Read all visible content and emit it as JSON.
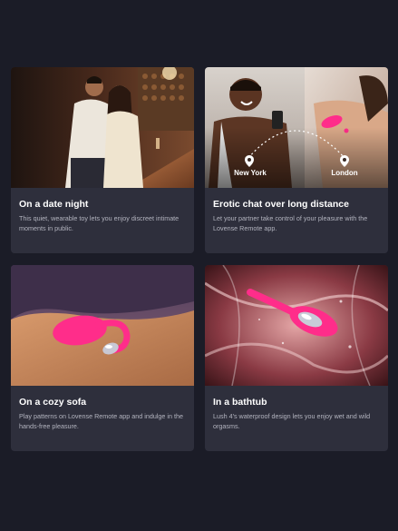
{
  "cards": [
    {
      "title": "On a date night",
      "description": "This quiet, wearable toy lets you enjoy discreet intimate moments in public.",
      "image": "couple-at-bar-photo"
    },
    {
      "title": "Erotic chat over long distance",
      "description": "Let your partner take control of your pleasure with the Lovense Remote app.",
      "image": "long-distance-couple-photo",
      "locations": [
        "New York",
        "London"
      ]
    },
    {
      "title": "On a cozy sofa",
      "description": "Play patterns on Lovense Remote app and indulge in the hands-free pleasure.",
      "image": "toy-on-sofa-photo"
    },
    {
      "title": "In a bathtub",
      "description": "Lush 4's waterproof design lets you enjoy wet and wild orgasms.",
      "image": "toy-in-water-photo"
    }
  ],
  "colors": {
    "background": "#1b1c27",
    "card": "#2e2f3c",
    "accent_pink": "#ff2d8a"
  },
  "icons": [
    "location-pin-icon"
  ]
}
